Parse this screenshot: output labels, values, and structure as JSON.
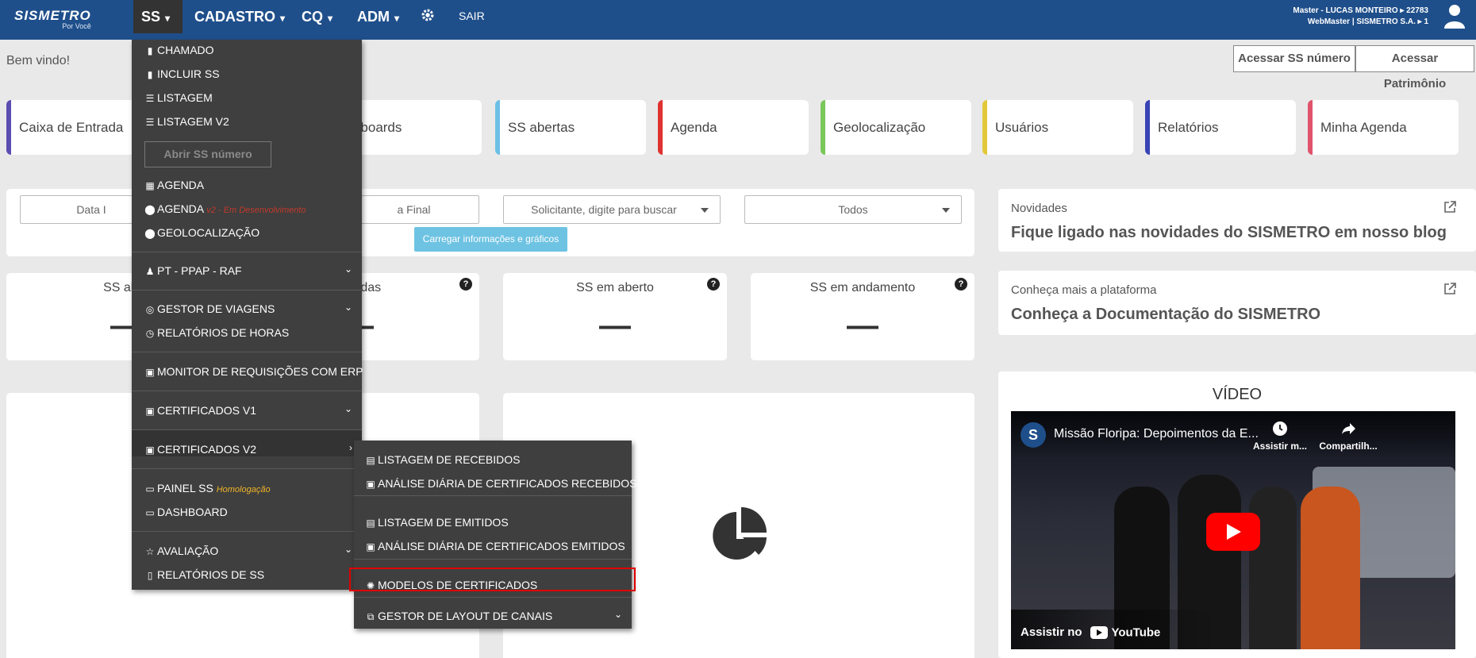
{
  "colors": {
    "topbar": "#1f4f8b",
    "menu_bg": "#3f3f3f",
    "highlight": "#e00000"
  },
  "brand": {
    "name": "SISMETRO",
    "tagline": "Por Você"
  },
  "nav": {
    "ss": "SS",
    "cadastro": "CADASTRO",
    "cq": "CQ",
    "adm": "ADM",
    "sair": "SAIR"
  },
  "user": {
    "line1": "Master - LUCAS MONTEIRO ▸ 22783",
    "line2": "WebMaster | SISMETRO S.A. ▸ 1"
  },
  "welcome": "Bem vindo!",
  "buttons": {
    "acessar_ss": "Acessar SS número",
    "acessar_patrimonio": "Acessar Patrimônio"
  },
  "tiles": [
    "Caixa de Entrada",
    "ashboards",
    "SS abertas",
    "Agenda",
    "Geolocalização",
    "Usuários",
    "Relatórios",
    "Minha Agenda"
  ],
  "tile_colors": [
    "#5b4db0",
    "#5a8fd6",
    "#6cc0e6",
    "#e03131",
    "#7ac75a",
    "#e3c93a",
    "#3844b5",
    "#e0536b"
  ],
  "filters": {
    "data_inicial": "Data I",
    "data_final": "a Final",
    "solicitante": "Solicitante, digite para buscar",
    "status": "Todos",
    "carregar": "Carregar informações e gráficos"
  },
  "stats": [
    {
      "label": "SS aber",
      "value": "—"
    },
    {
      "label": "cerradas",
      "value": "—"
    },
    {
      "label": "SS em aberto",
      "value": "—"
    },
    {
      "label": "SS em andamento",
      "value": "—"
    }
  ],
  "novidades": {
    "sub": "Novidades",
    "title": "Fique ligado nas novidades do SISMETRO em nosso blog"
  },
  "plataforma": {
    "sub": "Conheça mais a plataforma",
    "title": "Conheça a Documentação do SISMETRO"
  },
  "video": {
    "heading": "VÍDEO",
    "title": "Missão Floripa: Depoimentos da E...",
    "watch_later": "Assistir m...",
    "share": "Compartilh...",
    "watch_on": "Assistir no",
    "youtube": "YouTube"
  },
  "menu": {
    "chamado": "CHAMADO",
    "incluir": "INCLUIR SS",
    "listagem": "LISTAGEM",
    "listagem_v2": "LISTAGEM V2",
    "abrir": "Abrir SS número",
    "agenda": "AGENDA",
    "agenda2": "AGENDA",
    "agenda2_note": "v2 - Em Desenvolvimento",
    "geo": "GEOLOCALIZAÇÃO",
    "pt": "PT - PPAP - RAF",
    "gestor": "GESTOR DE VIAGENS",
    "relhoras": "RELATÓRIOS DE HORAS",
    "monitor": "MONITOR DE REQUISIÇÕES COM ERP",
    "cert_v1": "CERTIFICADOS V1",
    "cert_v2": "CERTIFICADOS V2",
    "painel": "PAINEL SS",
    "painel_note": "Homologação",
    "dashboard": "DASHBOARD",
    "avaliacao": "AVALIAÇÃO",
    "relss": "RELATÓRIOS DE SS"
  },
  "submenu": {
    "list_rec": "LISTAGEM DE RECEBIDOS",
    "anal_rec": "ANÁLISE DIÁRIA DE CERTIFICADOS RECEBIDOS",
    "list_emi": "LISTAGEM DE EMITIDOS",
    "anal_emi": "ANÁLISE DIÁRIA DE CERTIFICADOS EMITIDOS",
    "modelos": "MODELOS DE CERTIFICADOS",
    "gestor_layout": "GESTOR DE LAYOUT DE CANAIS"
  }
}
